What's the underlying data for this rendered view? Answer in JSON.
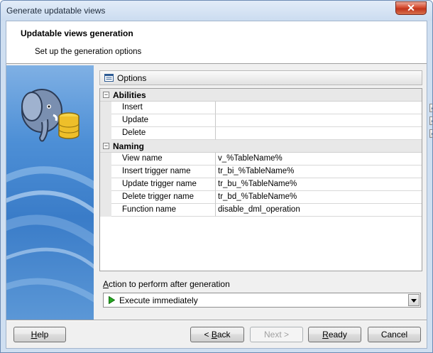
{
  "window": {
    "title": "Generate updatable views",
    "close_label": "✕"
  },
  "header": {
    "title": "Updatable views generation",
    "subtitle": "Set up the generation options"
  },
  "options": {
    "label": "Options"
  },
  "categories": [
    {
      "label": "Abilities",
      "toggle": "−",
      "rows": [
        {
          "name": "Insert",
          "type": "checkbox",
          "checked": true
        },
        {
          "name": "Update",
          "type": "checkbox",
          "checked": true
        },
        {
          "name": "Delete",
          "type": "checkbox",
          "checked": true
        }
      ]
    },
    {
      "label": "Naming",
      "toggle": "−",
      "rows": [
        {
          "name": "View name",
          "type": "text",
          "value": "v_%TableName%"
        },
        {
          "name": "Insert trigger name",
          "type": "text",
          "value": "tr_bi_%TableName%"
        },
        {
          "name": "Update trigger name",
          "type": "text",
          "value": "tr_bu_%TableName%"
        },
        {
          "name": "Delete trigger name",
          "type": "text",
          "value": "tr_bd_%TableName%"
        },
        {
          "name": "Function name",
          "type": "text",
          "value": "disable_dml_operation"
        }
      ]
    }
  ],
  "action": {
    "label_prefix": "A",
    "label_rest": "ction to perform after generation",
    "selected": "Execute immediately"
  },
  "buttons": {
    "help": {
      "mnemonic": "H",
      "rest": "elp"
    },
    "back": {
      "prefix": "< ",
      "mnemonic": "B",
      "rest": "ack"
    },
    "next": "Next >",
    "ready": {
      "mnemonic": "R",
      "rest": "eady"
    },
    "cancel": "Cancel"
  },
  "colors": {
    "accent_blue": "#3a7cc8",
    "checkmark": "#21425d",
    "close_red": "#c0351c"
  }
}
